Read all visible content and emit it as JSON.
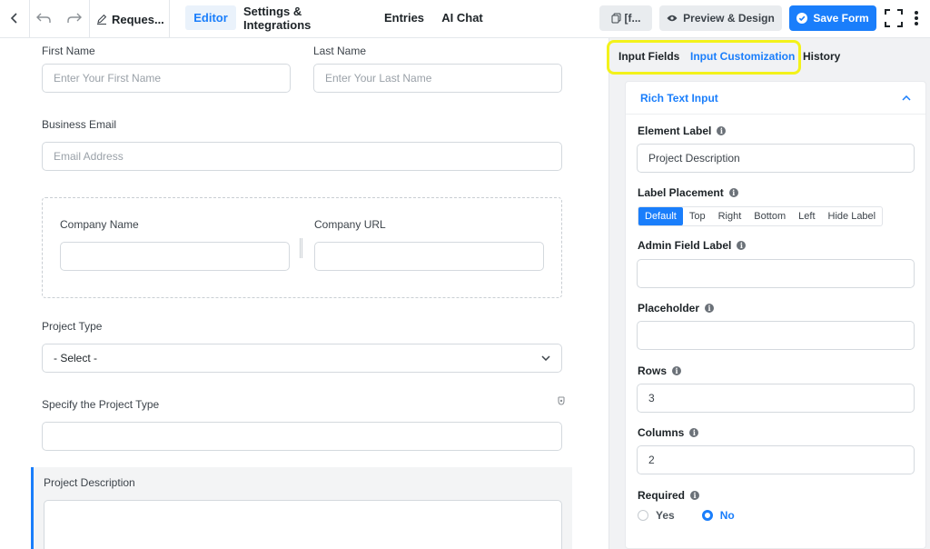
{
  "topbar": {
    "form_title": "Reques...",
    "tabs": [
      {
        "label": "Editor",
        "active": true
      },
      {
        "label": "Settings & Integrations",
        "active": false
      },
      {
        "label": "Entries",
        "active": false
      },
      {
        "label": "AI Chat",
        "active": false
      }
    ],
    "shortcode_label": "[f...",
    "preview_label": "Preview & Design",
    "save_label": "Save Form"
  },
  "form": {
    "first_name": {
      "label": "First Name",
      "placeholder": "Enter Your First Name"
    },
    "last_name": {
      "label": "Last Name",
      "placeholder": "Enter Your Last Name"
    },
    "business_email": {
      "label": "Business Email",
      "placeholder": "Email Address"
    },
    "company_name": {
      "label": "Company Name"
    },
    "company_url": {
      "label": "Company URL"
    },
    "project_type": {
      "label": "Project Type",
      "value": "- Select -"
    },
    "specify_project_type": {
      "label": "Specify the Project Type"
    },
    "project_description": {
      "label": "Project Description"
    }
  },
  "sidebar": {
    "tabs": [
      {
        "label": "Input Fields"
      },
      {
        "label": "Input Customization",
        "active": true
      },
      {
        "label": "History"
      }
    ],
    "panel_title": "Rich Text Input",
    "element_label": {
      "label": "Element Label",
      "value": "Project Description"
    },
    "label_placement": {
      "label": "Label Placement",
      "options": [
        "Default",
        "Top",
        "Right",
        "Bottom",
        "Left",
        "Hide Label"
      ],
      "selected": "Default"
    },
    "admin_field_label": {
      "label": "Admin Field Label",
      "value": ""
    },
    "placeholder": {
      "label": "Placeholder",
      "value": ""
    },
    "rows": {
      "label": "Rows",
      "value": "3"
    },
    "columns": {
      "label": "Columns",
      "value": "2"
    },
    "required": {
      "label": "Required",
      "options": [
        "Yes",
        "No"
      ],
      "selected": "No"
    }
  },
  "colors": {
    "accent": "#1a7efb",
    "highlight": "#f3f21a"
  }
}
